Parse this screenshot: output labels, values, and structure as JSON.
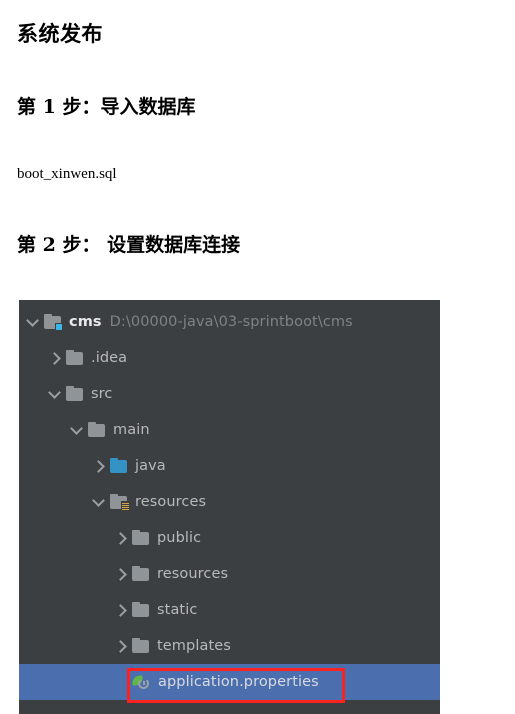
{
  "document": {
    "title": "系统发布",
    "step1_heading": "第 1 步：导入数据库",
    "step1_body": "boot_xinwen.sql",
    "step2_heading": "第 2 步： 设置数据库连接"
  },
  "ide_panel": {
    "background_color": "#3c3f41",
    "selection_color": "#4b6eaf",
    "text_color": "#b6b9be",
    "path_color": "#7e8287",
    "annotation_color": "#fb2222",
    "tree": [
      {
        "label": "cms",
        "path": "D:\\00000-java\\03-sprintboot\\cms",
        "icon": "module-folder-icon",
        "chevron": "chevron-down-icon",
        "depth": 0,
        "selected": false
      },
      {
        "label": ".idea",
        "path": "",
        "icon": "folder-icon",
        "chevron": "chevron-right-icon",
        "depth": 1,
        "selected": false
      },
      {
        "label": "src",
        "path": "",
        "icon": "folder-icon",
        "chevron": "chevron-down-icon",
        "depth": 1,
        "selected": false
      },
      {
        "label": "main",
        "path": "",
        "icon": "folder-icon",
        "chevron": "chevron-down-icon",
        "depth": 2,
        "selected": false
      },
      {
        "label": "java",
        "path": "",
        "icon": "source-folder-icon",
        "chevron": "chevron-right-icon",
        "depth": 3,
        "selected": false
      },
      {
        "label": "resources",
        "path": "",
        "icon": "resources-folder-icon",
        "chevron": "chevron-down-icon",
        "depth": 3,
        "selected": false
      },
      {
        "label": "public",
        "path": "",
        "icon": "folder-icon",
        "chevron": "chevron-right-icon",
        "depth": 4,
        "selected": false
      },
      {
        "label": "resources",
        "path": "",
        "icon": "folder-icon",
        "chevron": "chevron-right-icon",
        "depth": 4,
        "selected": false
      },
      {
        "label": "static",
        "path": "",
        "icon": "folder-icon",
        "chevron": "chevron-right-icon",
        "depth": 4,
        "selected": false
      },
      {
        "label": "templates",
        "path": "",
        "icon": "folder-icon",
        "chevron": "chevron-right-icon",
        "depth": 4,
        "selected": false
      },
      {
        "label": "application.properties",
        "path": "",
        "icon": "spring-boot-file-icon",
        "chevron": "none",
        "depth": 4,
        "selected": true
      }
    ]
  }
}
